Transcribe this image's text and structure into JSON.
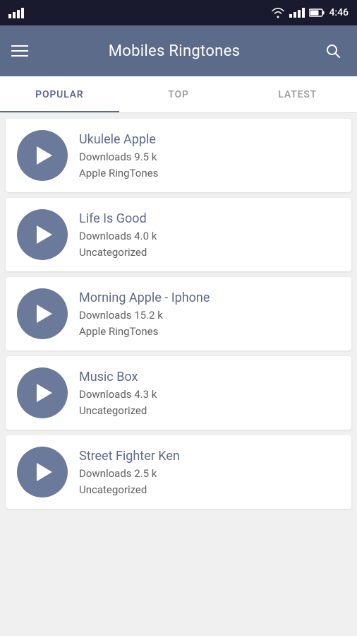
{
  "statusBar": {
    "time": "4:46"
  },
  "appBar": {
    "title": "Mobiles Ringtones",
    "menuLabel": "Menu",
    "searchLabel": "Search"
  },
  "tabs": [
    {
      "id": "popular",
      "label": "POPULAR",
      "active": true
    },
    {
      "id": "top",
      "label": "TOP",
      "active": false
    },
    {
      "id": "latest",
      "label": "LATEST",
      "active": false
    }
  ],
  "ringtones": [
    {
      "id": 1,
      "title": "Ukulele Apple",
      "downloads": "Downloads 9.5 k",
      "category": "Apple RingTones"
    },
    {
      "id": 2,
      "title": "Life Is Good",
      "downloads": "Downloads 4.0 k",
      "category": "Uncategorized"
    },
    {
      "id": 3,
      "title": "Morning Apple - Iphone",
      "downloads": "Downloads 15.2 k",
      "category": "Apple RingTones"
    },
    {
      "id": 4,
      "title": "Music Box",
      "downloads": "Downloads 4.3 k",
      "category": "Uncategorized"
    },
    {
      "id": 5,
      "title": "Street Fighter Ken",
      "downloads": "Downloads 2.5 k",
      "category": "Uncategorized"
    }
  ]
}
